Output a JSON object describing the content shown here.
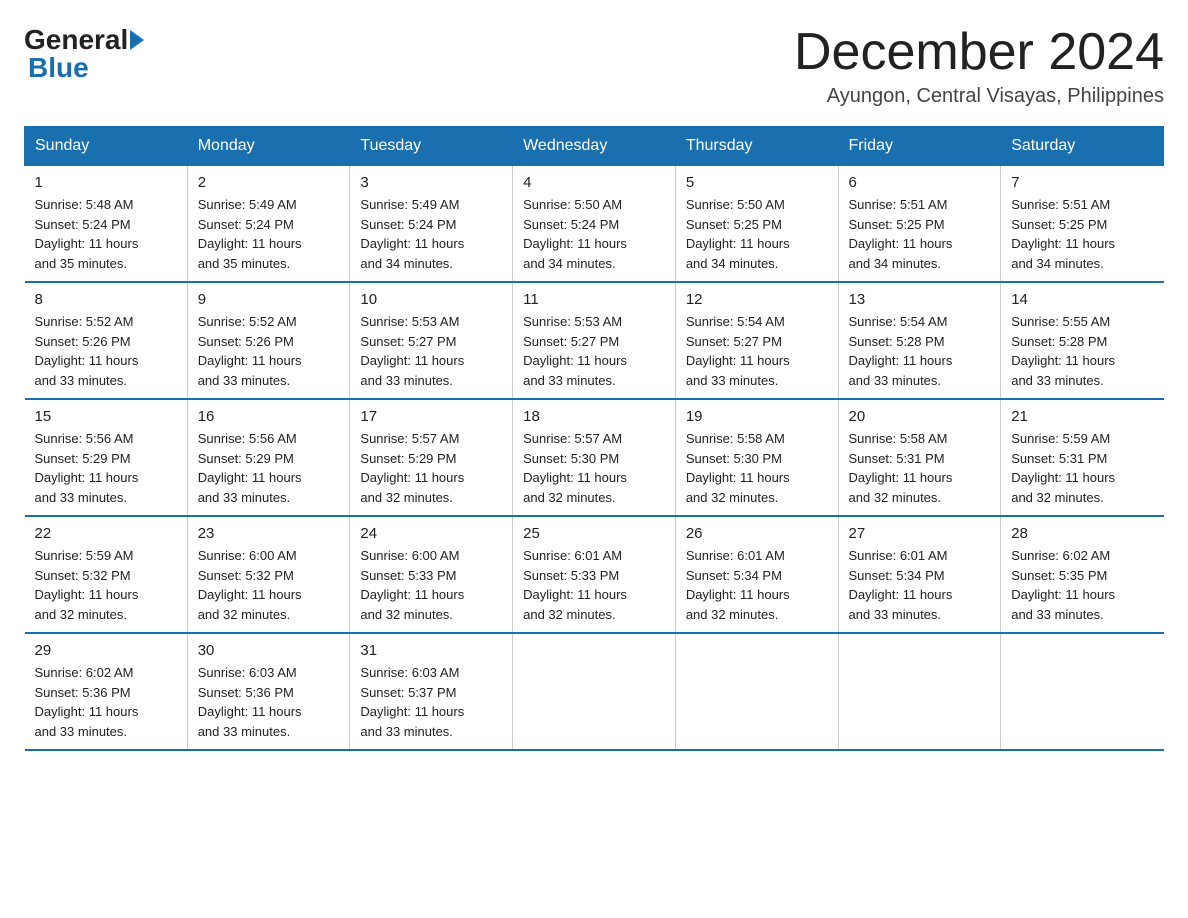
{
  "header": {
    "logo_general": "General",
    "logo_blue": "Blue",
    "month_title": "December 2024",
    "location": "Ayungon, Central Visayas, Philippines"
  },
  "weekdays": [
    "Sunday",
    "Monday",
    "Tuesday",
    "Wednesday",
    "Thursday",
    "Friday",
    "Saturday"
  ],
  "weeks": [
    [
      {
        "day": "1",
        "sunrise": "5:48 AM",
        "sunset": "5:24 PM",
        "daylight": "11 hours and 35 minutes."
      },
      {
        "day": "2",
        "sunrise": "5:49 AM",
        "sunset": "5:24 PM",
        "daylight": "11 hours and 35 minutes."
      },
      {
        "day": "3",
        "sunrise": "5:49 AM",
        "sunset": "5:24 PM",
        "daylight": "11 hours and 34 minutes."
      },
      {
        "day": "4",
        "sunrise": "5:50 AM",
        "sunset": "5:24 PM",
        "daylight": "11 hours and 34 minutes."
      },
      {
        "day": "5",
        "sunrise": "5:50 AM",
        "sunset": "5:25 PM",
        "daylight": "11 hours and 34 minutes."
      },
      {
        "day": "6",
        "sunrise": "5:51 AM",
        "sunset": "5:25 PM",
        "daylight": "11 hours and 34 minutes."
      },
      {
        "day": "7",
        "sunrise": "5:51 AM",
        "sunset": "5:25 PM",
        "daylight": "11 hours and 34 minutes."
      }
    ],
    [
      {
        "day": "8",
        "sunrise": "5:52 AM",
        "sunset": "5:26 PM",
        "daylight": "11 hours and 33 minutes."
      },
      {
        "day": "9",
        "sunrise": "5:52 AM",
        "sunset": "5:26 PM",
        "daylight": "11 hours and 33 minutes."
      },
      {
        "day": "10",
        "sunrise": "5:53 AM",
        "sunset": "5:27 PM",
        "daylight": "11 hours and 33 minutes."
      },
      {
        "day": "11",
        "sunrise": "5:53 AM",
        "sunset": "5:27 PM",
        "daylight": "11 hours and 33 minutes."
      },
      {
        "day": "12",
        "sunrise": "5:54 AM",
        "sunset": "5:27 PM",
        "daylight": "11 hours and 33 minutes."
      },
      {
        "day": "13",
        "sunrise": "5:54 AM",
        "sunset": "5:28 PM",
        "daylight": "11 hours and 33 minutes."
      },
      {
        "day": "14",
        "sunrise": "5:55 AM",
        "sunset": "5:28 PM",
        "daylight": "11 hours and 33 minutes."
      }
    ],
    [
      {
        "day": "15",
        "sunrise": "5:56 AM",
        "sunset": "5:29 PM",
        "daylight": "11 hours and 33 minutes."
      },
      {
        "day": "16",
        "sunrise": "5:56 AM",
        "sunset": "5:29 PM",
        "daylight": "11 hours and 33 minutes."
      },
      {
        "day": "17",
        "sunrise": "5:57 AM",
        "sunset": "5:29 PM",
        "daylight": "11 hours and 32 minutes."
      },
      {
        "day": "18",
        "sunrise": "5:57 AM",
        "sunset": "5:30 PM",
        "daylight": "11 hours and 32 minutes."
      },
      {
        "day": "19",
        "sunrise": "5:58 AM",
        "sunset": "5:30 PM",
        "daylight": "11 hours and 32 minutes."
      },
      {
        "day": "20",
        "sunrise": "5:58 AM",
        "sunset": "5:31 PM",
        "daylight": "11 hours and 32 minutes."
      },
      {
        "day": "21",
        "sunrise": "5:59 AM",
        "sunset": "5:31 PM",
        "daylight": "11 hours and 32 minutes."
      }
    ],
    [
      {
        "day": "22",
        "sunrise": "5:59 AM",
        "sunset": "5:32 PM",
        "daylight": "11 hours and 32 minutes."
      },
      {
        "day": "23",
        "sunrise": "6:00 AM",
        "sunset": "5:32 PM",
        "daylight": "11 hours and 32 minutes."
      },
      {
        "day": "24",
        "sunrise": "6:00 AM",
        "sunset": "5:33 PM",
        "daylight": "11 hours and 32 minutes."
      },
      {
        "day": "25",
        "sunrise": "6:01 AM",
        "sunset": "5:33 PM",
        "daylight": "11 hours and 32 minutes."
      },
      {
        "day": "26",
        "sunrise": "6:01 AM",
        "sunset": "5:34 PM",
        "daylight": "11 hours and 32 minutes."
      },
      {
        "day": "27",
        "sunrise": "6:01 AM",
        "sunset": "5:34 PM",
        "daylight": "11 hours and 33 minutes."
      },
      {
        "day": "28",
        "sunrise": "6:02 AM",
        "sunset": "5:35 PM",
        "daylight": "11 hours and 33 minutes."
      }
    ],
    [
      {
        "day": "29",
        "sunrise": "6:02 AM",
        "sunset": "5:36 PM",
        "daylight": "11 hours and 33 minutes."
      },
      {
        "day": "30",
        "sunrise": "6:03 AM",
        "sunset": "5:36 PM",
        "daylight": "11 hours and 33 minutes."
      },
      {
        "day": "31",
        "sunrise": "6:03 AM",
        "sunset": "5:37 PM",
        "daylight": "11 hours and 33 minutes."
      },
      null,
      null,
      null,
      null
    ]
  ]
}
